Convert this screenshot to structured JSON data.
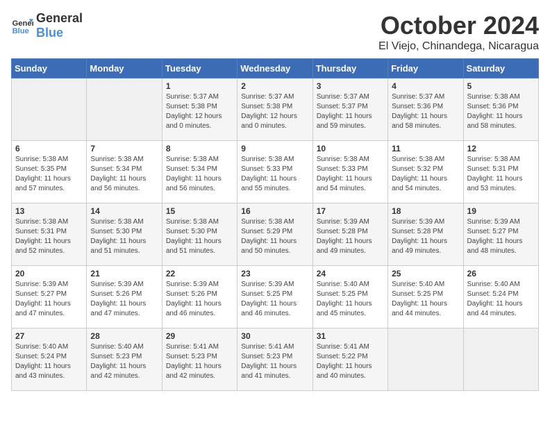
{
  "header": {
    "logo_general": "General",
    "logo_blue": "Blue",
    "title": "October 2024",
    "subtitle": "El Viejo, Chinandega, Nicaragua"
  },
  "weekdays": [
    "Sunday",
    "Monday",
    "Tuesday",
    "Wednesday",
    "Thursday",
    "Friday",
    "Saturday"
  ],
  "weeks": [
    [
      {
        "day": "",
        "detail": ""
      },
      {
        "day": "",
        "detail": ""
      },
      {
        "day": "1",
        "detail": "Sunrise: 5:37 AM\nSunset: 5:38 PM\nDaylight: 12 hours\nand 0 minutes."
      },
      {
        "day": "2",
        "detail": "Sunrise: 5:37 AM\nSunset: 5:38 PM\nDaylight: 12 hours\nand 0 minutes."
      },
      {
        "day": "3",
        "detail": "Sunrise: 5:37 AM\nSunset: 5:37 PM\nDaylight: 11 hours\nand 59 minutes."
      },
      {
        "day": "4",
        "detail": "Sunrise: 5:37 AM\nSunset: 5:36 PM\nDaylight: 11 hours\nand 58 minutes."
      },
      {
        "day": "5",
        "detail": "Sunrise: 5:38 AM\nSunset: 5:36 PM\nDaylight: 11 hours\nand 58 minutes."
      }
    ],
    [
      {
        "day": "6",
        "detail": "Sunrise: 5:38 AM\nSunset: 5:35 PM\nDaylight: 11 hours\nand 57 minutes."
      },
      {
        "day": "7",
        "detail": "Sunrise: 5:38 AM\nSunset: 5:34 PM\nDaylight: 11 hours\nand 56 minutes."
      },
      {
        "day": "8",
        "detail": "Sunrise: 5:38 AM\nSunset: 5:34 PM\nDaylight: 11 hours\nand 56 minutes."
      },
      {
        "day": "9",
        "detail": "Sunrise: 5:38 AM\nSunset: 5:33 PM\nDaylight: 11 hours\nand 55 minutes."
      },
      {
        "day": "10",
        "detail": "Sunrise: 5:38 AM\nSunset: 5:33 PM\nDaylight: 11 hours\nand 54 minutes."
      },
      {
        "day": "11",
        "detail": "Sunrise: 5:38 AM\nSunset: 5:32 PM\nDaylight: 11 hours\nand 54 minutes."
      },
      {
        "day": "12",
        "detail": "Sunrise: 5:38 AM\nSunset: 5:31 PM\nDaylight: 11 hours\nand 53 minutes."
      }
    ],
    [
      {
        "day": "13",
        "detail": "Sunrise: 5:38 AM\nSunset: 5:31 PM\nDaylight: 11 hours\nand 52 minutes."
      },
      {
        "day": "14",
        "detail": "Sunrise: 5:38 AM\nSunset: 5:30 PM\nDaylight: 11 hours\nand 51 minutes."
      },
      {
        "day": "15",
        "detail": "Sunrise: 5:38 AM\nSunset: 5:30 PM\nDaylight: 11 hours\nand 51 minutes."
      },
      {
        "day": "16",
        "detail": "Sunrise: 5:38 AM\nSunset: 5:29 PM\nDaylight: 11 hours\nand 50 minutes."
      },
      {
        "day": "17",
        "detail": "Sunrise: 5:39 AM\nSunset: 5:28 PM\nDaylight: 11 hours\nand 49 minutes."
      },
      {
        "day": "18",
        "detail": "Sunrise: 5:39 AM\nSunset: 5:28 PM\nDaylight: 11 hours\nand 49 minutes."
      },
      {
        "day": "19",
        "detail": "Sunrise: 5:39 AM\nSunset: 5:27 PM\nDaylight: 11 hours\nand 48 minutes."
      }
    ],
    [
      {
        "day": "20",
        "detail": "Sunrise: 5:39 AM\nSunset: 5:27 PM\nDaylight: 11 hours\nand 47 minutes."
      },
      {
        "day": "21",
        "detail": "Sunrise: 5:39 AM\nSunset: 5:26 PM\nDaylight: 11 hours\nand 47 minutes."
      },
      {
        "day": "22",
        "detail": "Sunrise: 5:39 AM\nSunset: 5:26 PM\nDaylight: 11 hours\nand 46 minutes."
      },
      {
        "day": "23",
        "detail": "Sunrise: 5:39 AM\nSunset: 5:25 PM\nDaylight: 11 hours\nand 46 minutes."
      },
      {
        "day": "24",
        "detail": "Sunrise: 5:40 AM\nSunset: 5:25 PM\nDaylight: 11 hours\nand 45 minutes."
      },
      {
        "day": "25",
        "detail": "Sunrise: 5:40 AM\nSunset: 5:25 PM\nDaylight: 11 hours\nand 44 minutes."
      },
      {
        "day": "26",
        "detail": "Sunrise: 5:40 AM\nSunset: 5:24 PM\nDaylight: 11 hours\nand 44 minutes."
      }
    ],
    [
      {
        "day": "27",
        "detail": "Sunrise: 5:40 AM\nSunset: 5:24 PM\nDaylight: 11 hours\nand 43 minutes."
      },
      {
        "day": "28",
        "detail": "Sunrise: 5:40 AM\nSunset: 5:23 PM\nDaylight: 11 hours\nand 42 minutes."
      },
      {
        "day": "29",
        "detail": "Sunrise: 5:41 AM\nSunset: 5:23 PM\nDaylight: 11 hours\nand 42 minutes."
      },
      {
        "day": "30",
        "detail": "Sunrise: 5:41 AM\nSunset: 5:23 PM\nDaylight: 11 hours\nand 41 minutes."
      },
      {
        "day": "31",
        "detail": "Sunrise: 5:41 AM\nSunset: 5:22 PM\nDaylight: 11 hours\nand 40 minutes."
      },
      {
        "day": "",
        "detail": ""
      },
      {
        "day": "",
        "detail": ""
      }
    ]
  ]
}
